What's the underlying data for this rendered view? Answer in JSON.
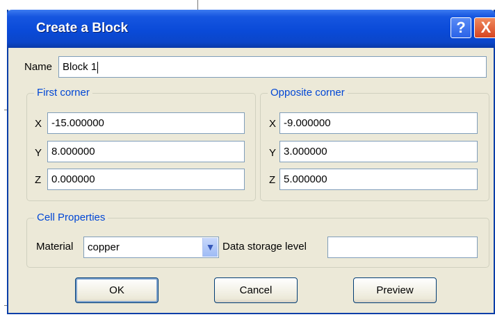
{
  "window": {
    "title": "Create a Block",
    "help_label": "?",
    "close_label": "X"
  },
  "name": {
    "label": "Name",
    "value": "Block 1"
  },
  "first_corner": {
    "legend": "First corner",
    "x": {
      "label": "X",
      "value": "-15.000000"
    },
    "y": {
      "label": "Y",
      "value": "8.000000"
    },
    "z": {
      "label": "Z",
      "value": "0.000000"
    }
  },
  "opposite_corner": {
    "legend": "Opposite corner",
    "x": {
      "label": "X",
      "value": "-9.000000"
    },
    "y": {
      "label": "Y",
      "value": "3.000000"
    },
    "z": {
      "label": "Z",
      "value": "5.000000"
    }
  },
  "cell_properties": {
    "legend": "Cell Properties",
    "material_label": "Material",
    "material_value": "copper",
    "storage_label": "Data storage level",
    "storage_value": ""
  },
  "buttons": {
    "ok": "OK",
    "cancel": "Cancel",
    "preview": "Preview"
  }
}
